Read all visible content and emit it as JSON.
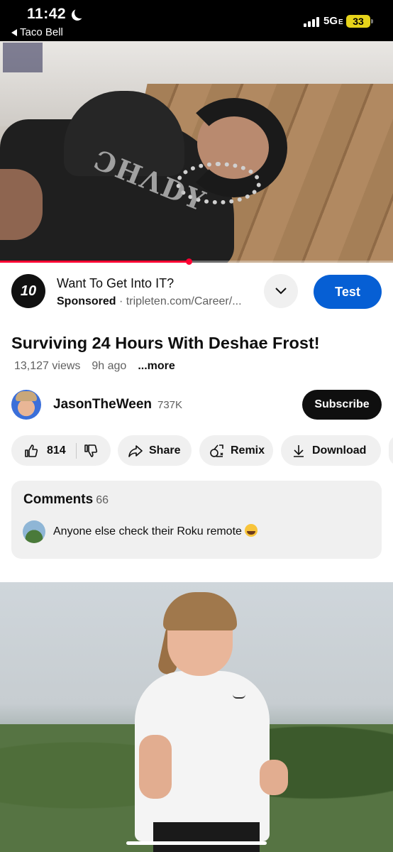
{
  "status_bar": {
    "time": "11:42",
    "back_app": "Taco Bell",
    "network": "5G",
    "network_suffix": "E",
    "battery": "33"
  },
  "video": {
    "progress_fraction": 0.48,
    "player_accent": "#ff0033"
  },
  "ad": {
    "logo_text": "10",
    "title": "Want To Get Into IT?",
    "sponsored_label": "Sponsored",
    "url": "tripleten.com/Career/...",
    "cta_label": "Test",
    "cta_color": "#065fd4"
  },
  "video_info": {
    "title": "Surviving 24 Hours With Deshae Frost!",
    "views": "13,127 views",
    "age": "9h ago",
    "more_label": "...more"
  },
  "channel": {
    "name": "JasonTheWeen",
    "subscribers": "737K",
    "subscribe_label": "Subscribe"
  },
  "actions": {
    "like_count": "814",
    "share_label": "Share",
    "remix_label": "Remix",
    "download_label": "Download"
  },
  "comments": {
    "header": "Comments",
    "count": "66",
    "top_comment": "Anyone else check their Roku remote"
  }
}
